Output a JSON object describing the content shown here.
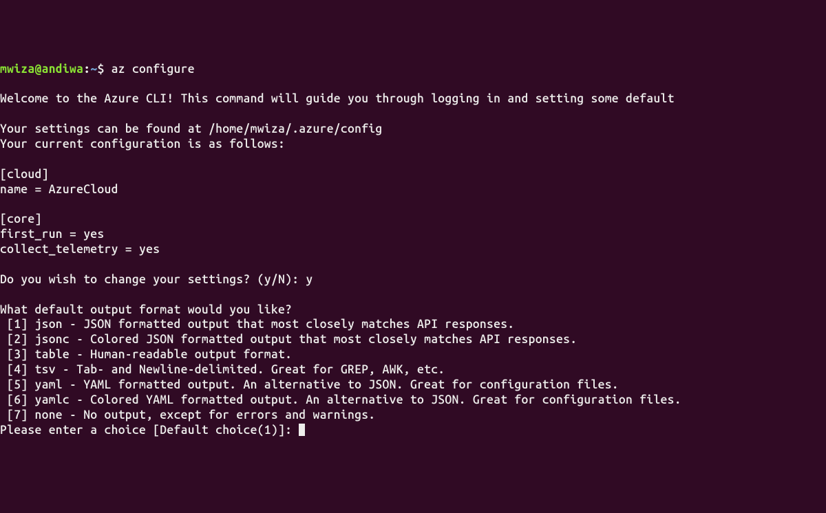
{
  "prompt": {
    "user": "mwiza",
    "at": "@",
    "host": "andiwa",
    "colon": ":",
    "tilde": "~",
    "dollar": "$",
    "command": "az configure"
  },
  "lines": {
    "welcome": "Welcome to the Azure CLI! This command will guide you through logging in and setting some default",
    "settings_path": "Your settings can be found at /home/mwiza/.azure/config",
    "current_config": "Your current configuration is as follows:",
    "cloud_header": "[cloud]",
    "cloud_name": "name = AzureCloud",
    "core_header": "[core]",
    "core_first_run": "first_run = yes",
    "core_telemetry": "collect_telemetry = yes",
    "change_prompt": "Do you wish to change your settings? (y/N): y",
    "format_question": "What default output format would you like?",
    "opt1": " [1] json - JSON formatted output that most closely matches API responses.",
    "opt2": " [2] jsonc - Colored JSON formatted output that most closely matches API responses.",
    "opt3": " [3] table - Human-readable output format.",
    "opt4": " [4] tsv - Tab- and Newline-delimited. Great for GREP, AWK, etc.",
    "opt5": " [5] yaml - YAML formatted output. An alternative to JSON. Great for configuration files.",
    "opt6": " [6] yamlc - Colored YAML formatted output. An alternative to JSON. Great for configuration files.",
    "opt7": " [7] none - No output, except for errors and warnings.",
    "enter_choice": "Please enter a choice [Default choice(1)]: "
  }
}
